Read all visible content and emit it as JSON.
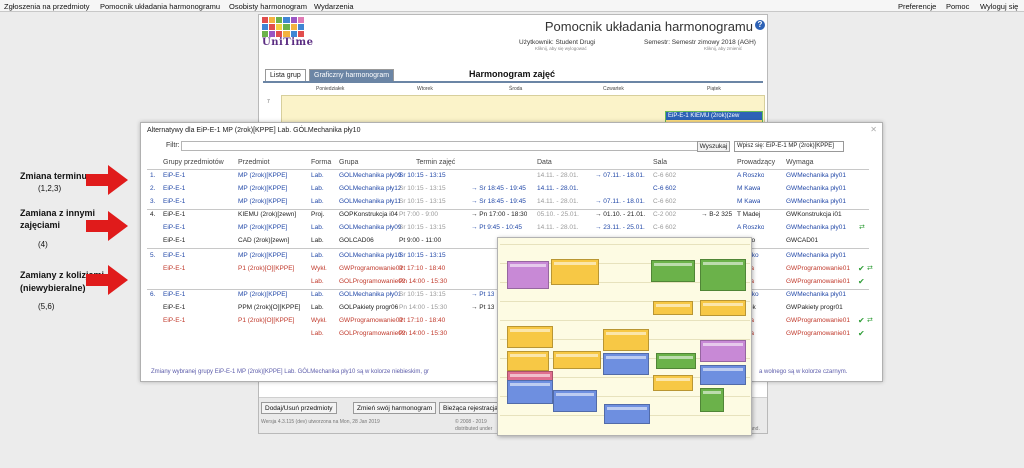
{
  "menu": {
    "left": [
      "Zgłoszenia na przedmioty",
      "Pomocnik układania harmonogramu",
      "Osobisty harmonogram",
      "Wydarzenia"
    ],
    "right": [
      "Preferencje",
      "Pomoc",
      "Wyloguj się"
    ]
  },
  "app": {
    "logo_text": "UniTime",
    "title": "Pomocnik układania harmonogramu",
    "user_line": "Użytkownik: Student Drugi",
    "user_hint": "Kliknij, aby się wylogować",
    "session_line": "Semestr: Semestr zimowy 2018 (AGH)",
    "session_hint": "Kliknij, aby zmienić",
    "tabs": [
      "Lista grup",
      "Graficzny harmonogram"
    ],
    "schedule_title": "Harmonogram zajęć",
    "days": [
      "Poniedziałek",
      "Wtorek",
      "Środa",
      "Czwartek",
      "Piątek"
    ],
    "hour": "7",
    "class_card": "EiP-E-1 KIEMU (2rok)(zew",
    "bottom_buttons": [
      "Dodaj/Usuń przedmioty",
      "Zmień swój harmonogram",
      "Bieżąca rejestracja"
    ],
    "footer_version": "Wersja 4.3.115 (dev) utworzona na Mon, 28 Jan 2019",
    "footer_copy": "© 2008 - 2019",
    "footer_dist": "distributed under",
    "footer_right": "land."
  },
  "modal": {
    "title": "Alternatywy dla EiP-E-1 MP (2rok)[KPPE] Lab. GÓLMechanika pły10",
    "filter_label": "Filtr:",
    "search_button": "Wyszukaj",
    "register_value": "Wpisz się: EiP-E-1 MP (2rok)[KPPE]",
    "columns": [
      "Grupy przedmiotów",
      "Przedmiot",
      "Forma",
      "Grupa",
      "Termin zajęć",
      "Data",
      "Sala",
      "Prowadzący",
      "Wymaga"
    ],
    "rows": [
      {
        "num": "1.",
        "group": "EiP-E-1",
        "subject": "MP (2rok)[KPPE]",
        "form": "Lab.",
        "grupa": "GÓLMechanika pły09",
        "time": "Śr 10:15 - 13:15",
        "date": "14.11. - 28.01.",
        "date2": "→ 07.11. - 18.01.",
        "room": "C-6 602",
        "room2": "",
        "teacher": "A Roszko",
        "req": "GWMechanika pły01",
        "color": "blue",
        "icons": ""
      },
      {
        "num": "2.",
        "group": "EiP-E-1",
        "subject": "MP (2rok)[KPPE]",
        "form": "Lab.",
        "grupa": "GÓLMechanika pły12",
        "time": "Śr 10:15 - 13:15",
        "time2": "→ Śr 18:45 - 19:45",
        "date": "14.11. - 28.01.",
        "date2": "",
        "room": "C-6 602",
        "room2": "",
        "teacher": "M Kawa",
        "req": "GWMechanika pły01",
        "color": "blue",
        "icons": ""
      },
      {
        "num": "3.",
        "group": "EiP-E-1",
        "subject": "MP (2rok)[KPPE]",
        "form": "Lab.",
        "grupa": "GÓLMechanika pły11",
        "time": "Śr 10:15 - 13:15",
        "time2": "→ Śr 18:45 - 19:45",
        "date": "14.11. - 28.01.",
        "date2": "→ 07.11. - 18.01.",
        "room": "C-6 602",
        "room2": "",
        "teacher": "M Kawa",
        "req": "GWMechanika pły01",
        "color": "blue",
        "icons": ""
      },
      {
        "num": "4.",
        "group": "EiP-E-1",
        "subject": "KIEMU (2rok)[zewn]",
        "form": "Proj.",
        "grupa": "GÓPKonstrukcja i04",
        "time": "Pt 7:00 - 9:00",
        "time2": "→ Pn 17:00 - 18:30",
        "date": "05.10. - 25.01.",
        "date2": "→ 01.10. - 21.01.",
        "room": "C-2 002",
        "room2": "→ B-2 325",
        "teacher": "T Madej",
        "req": "GWKonstrukcja i01",
        "color": "dark",
        "icons": ""
      },
      {
        "num": "",
        "group": "EiP-E-1",
        "subject": "MP (2rok)[KPPE]",
        "form": "Lab.",
        "grupa": "GÓLMechanika pły09",
        "time": "Śr 10:15 - 13:15",
        "time2": "→ Pt 9:45 - 10:45",
        "date": "14.11. - 28.01.",
        "date2": "→ 23.11. - 25.01.",
        "room": "C-6 602",
        "room2": "",
        "teacher": "A Roszko",
        "req": "GWMechanika pły01",
        "color": "blue",
        "icons": "swap"
      },
      {
        "num": "",
        "group": "EiP-E-1",
        "subject": "CAD (2rok)[zewn]",
        "form": "Lab.",
        "grupa": "GÓLCAD06",
        "time": "Pt 9:00 - 11:00",
        "time2": "",
        "date": "",
        "date2": "",
        "room": "",
        "room2": "",
        "teacher": "Packo",
        "req": "GWCAD01",
        "color": "dark",
        "icons": ""
      },
      {
        "num": "5.",
        "group": "EiP-E-1",
        "subject": "MP (2rok)[KPPE]",
        "form": "Lab.",
        "grupa": "GÓLMechanika pły10",
        "time": "Śr 10:15 - 13:15",
        "time2": "",
        "date": "",
        "date2": "",
        "room": "",
        "room2": "",
        "teacher": "Roszko",
        "req": "GWMechanika pły01",
        "color": "blue",
        "icons": ""
      },
      {
        "num": "",
        "group": "EiP-E-1",
        "subject": "P1 (2rok)[O][KPPE]",
        "form": "Wykł.",
        "grupa": "GWProgramowanie01",
        "time": "Pt 17:10 - 18:40",
        "time2": "",
        "date": "",
        "date2": "",
        "room": "",
        "room2": "",
        "teacher": "Holda",
        "req": "GWProgramowanie01",
        "color": "red",
        "icons": "check-swap"
      },
      {
        "num": "",
        "group": "",
        "subject": "",
        "form": "Lab.",
        "grupa": "GÓLProgramowanie02",
        "time": "Pn 14:00 - 15:30",
        "time2": "",
        "date": "",
        "date2": "",
        "room": "",
        "room2": "",
        "teacher": "Holda",
        "req": "GWProgramowanie01",
        "color": "red",
        "icons": "check"
      },
      {
        "num": "6.",
        "group": "EiP-E-1",
        "subject": "MP (2rok)[KPPE]",
        "form": "Lab.",
        "grupa": "GÓLMechanika pły01",
        "time": "Śr 10:15 - 13:15",
        "time2": "→ Pt 13",
        "date": "",
        "date2": "",
        "room": "",
        "room2": "",
        "teacher": "Roszko",
        "req": "GWMechanika pły01",
        "color": "blue",
        "icons": ""
      },
      {
        "num": "",
        "group": "EiP-E-1",
        "subject": "PPM (2rok)[O][KPPE]",
        "form": "Lab.",
        "grupa": "GÓLPakiety progr06",
        "time": "Pn 14:00 - 15:30",
        "time2": "→ Pt 13",
        "date": "",
        "date2": "",
        "room": "",
        "room2": "",
        "teacher": "Dudek",
        "req": "GWPakiety progr01",
        "color": "dark",
        "icons": ""
      },
      {
        "num": "",
        "group": "EiP-E-1",
        "subject": "P1 (2rok)[O][KPPE]",
        "form": "Wykł.",
        "grupa": "GWProgramowanie01",
        "time": "Pt 17:10 - 18:40",
        "time2": "",
        "date": "",
        "date2": "",
        "room": "",
        "room2": "",
        "teacher": "Holda",
        "req": "GWProgramowanie01",
        "color": "red",
        "icons": "check-swap"
      },
      {
        "num": "",
        "group": "",
        "subject": "",
        "form": "Lab.",
        "grupa": "GÓLProgramowanie02",
        "time": "Pn 14:00 - 15:30",
        "time2": "",
        "date": "",
        "date2": "",
        "room": "",
        "room2": "",
        "teacher": "Holda",
        "req": "GWProgramowanie01",
        "color": "red",
        "icons": "check"
      }
    ],
    "legend": "Zmiany wybranej grupy EiP-E-1 MP (2rok)[KPPE] Lab. GÓLMechanika pły10 są w kolorze niebieskim, gr",
    "legend_right": "a wolnego są w kolorze czarnym."
  },
  "annotations": {
    "a1_title": "Zmiana terminu",
    "a1_nums": "(1,2,3)",
    "a2_title1": "Zamiana z innymi",
    "a2_title2": "zajęciami",
    "a2_nums": "(4)",
    "a3_title1": "Zamiany z kolizjami",
    "a3_title2": "(niewybieralne)",
    "a3_nums": "(5,6)",
    "arrow_color": "#e01b1b"
  }
}
